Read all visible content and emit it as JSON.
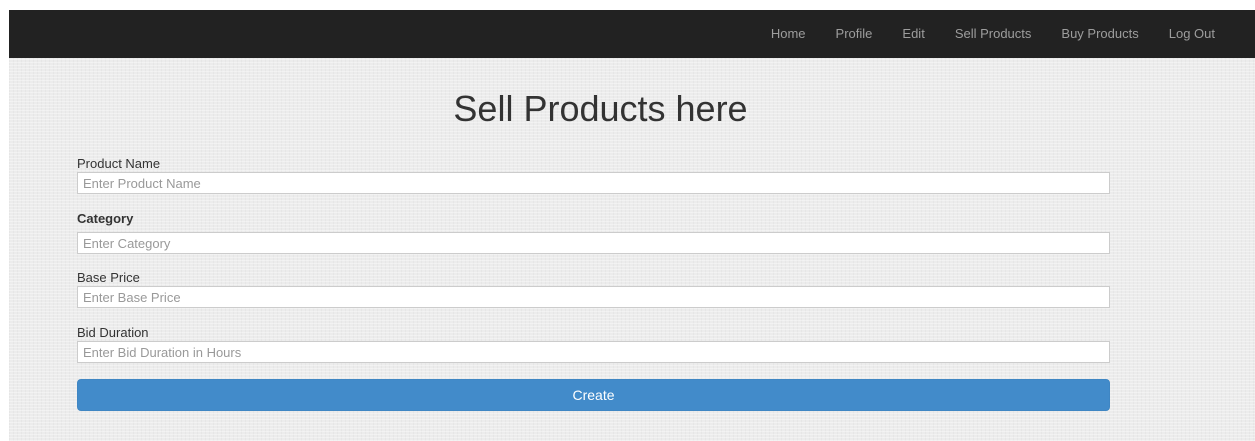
{
  "navbar": {
    "links": [
      {
        "label": "Home"
      },
      {
        "label": "Profile"
      },
      {
        "label": "Edit"
      },
      {
        "label": "Sell Products"
      },
      {
        "label": "Buy Products"
      },
      {
        "label": "Log Out"
      }
    ]
  },
  "page": {
    "title": "Sell Products here"
  },
  "form": {
    "product_name": {
      "label": "Product Name",
      "placeholder": "Enter Product Name",
      "value": ""
    },
    "category": {
      "label": "Category",
      "placeholder": "Enter Category",
      "value": ""
    },
    "base_price": {
      "label": "Base Price",
      "placeholder": "Enter Base Price",
      "value": ""
    },
    "bid_duration": {
      "label": "Bid Duration",
      "placeholder": "Enter Bid Duration in Hours",
      "value": ""
    },
    "submit_label": "Create"
  },
  "colors": {
    "navbar_bg": "#222222",
    "nav_link": "#9d9d9d",
    "primary_button": "#428bca",
    "page_bg": "#ececec"
  }
}
